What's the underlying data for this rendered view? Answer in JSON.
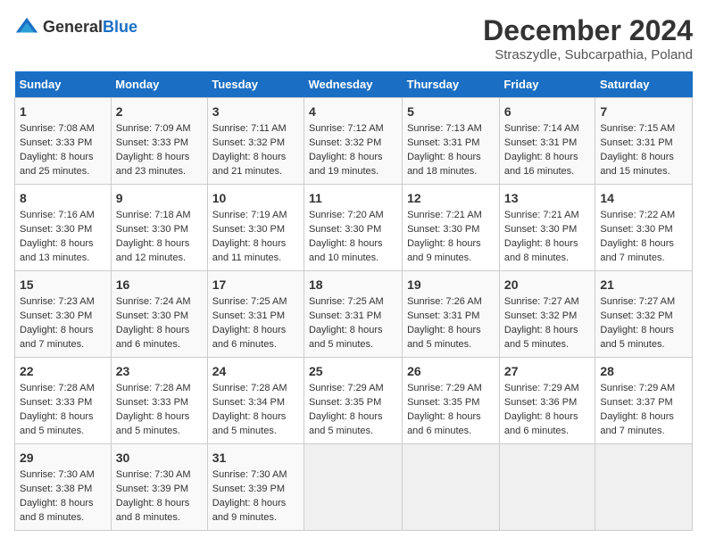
{
  "logo": {
    "general": "General",
    "blue": "Blue"
  },
  "title": "December 2024",
  "subtitle": "Straszydle, Subcarpathia, Poland",
  "days_header": [
    "Sunday",
    "Monday",
    "Tuesday",
    "Wednesday",
    "Thursday",
    "Friday",
    "Saturday"
  ],
  "weeks": [
    [
      {
        "day": "1",
        "sunrise": "7:08 AM",
        "sunset": "3:33 PM",
        "daylight": "8 hours and 25 minutes."
      },
      {
        "day": "2",
        "sunrise": "7:09 AM",
        "sunset": "3:33 PM",
        "daylight": "8 hours and 23 minutes."
      },
      {
        "day": "3",
        "sunrise": "7:11 AM",
        "sunset": "3:32 PM",
        "daylight": "8 hours and 21 minutes."
      },
      {
        "day": "4",
        "sunrise": "7:12 AM",
        "sunset": "3:32 PM",
        "daylight": "8 hours and 19 minutes."
      },
      {
        "day": "5",
        "sunrise": "7:13 AM",
        "sunset": "3:31 PM",
        "daylight": "8 hours and 18 minutes."
      },
      {
        "day": "6",
        "sunrise": "7:14 AM",
        "sunset": "3:31 PM",
        "daylight": "8 hours and 16 minutes."
      },
      {
        "day": "7",
        "sunrise": "7:15 AM",
        "sunset": "3:31 PM",
        "daylight": "8 hours and 15 minutes."
      }
    ],
    [
      {
        "day": "8",
        "sunrise": "7:16 AM",
        "sunset": "3:30 PM",
        "daylight": "8 hours and 13 minutes."
      },
      {
        "day": "9",
        "sunrise": "7:18 AM",
        "sunset": "3:30 PM",
        "daylight": "8 hours and 12 minutes."
      },
      {
        "day": "10",
        "sunrise": "7:19 AM",
        "sunset": "3:30 PM",
        "daylight": "8 hours and 11 minutes."
      },
      {
        "day": "11",
        "sunrise": "7:20 AM",
        "sunset": "3:30 PM",
        "daylight": "8 hours and 10 minutes."
      },
      {
        "day": "12",
        "sunrise": "7:21 AM",
        "sunset": "3:30 PM",
        "daylight": "8 hours and 9 minutes."
      },
      {
        "day": "13",
        "sunrise": "7:21 AM",
        "sunset": "3:30 PM",
        "daylight": "8 hours and 8 minutes."
      },
      {
        "day": "14",
        "sunrise": "7:22 AM",
        "sunset": "3:30 PM",
        "daylight": "8 hours and 7 minutes."
      }
    ],
    [
      {
        "day": "15",
        "sunrise": "7:23 AM",
        "sunset": "3:30 PM",
        "daylight": "8 hours and 7 minutes."
      },
      {
        "day": "16",
        "sunrise": "7:24 AM",
        "sunset": "3:30 PM",
        "daylight": "8 hours and 6 minutes."
      },
      {
        "day": "17",
        "sunrise": "7:25 AM",
        "sunset": "3:31 PM",
        "daylight": "8 hours and 6 minutes."
      },
      {
        "day": "18",
        "sunrise": "7:25 AM",
        "sunset": "3:31 PM",
        "daylight": "8 hours and 5 minutes."
      },
      {
        "day": "19",
        "sunrise": "7:26 AM",
        "sunset": "3:31 PM",
        "daylight": "8 hours and 5 minutes."
      },
      {
        "day": "20",
        "sunrise": "7:27 AM",
        "sunset": "3:32 PM",
        "daylight": "8 hours and 5 minutes."
      },
      {
        "day": "21",
        "sunrise": "7:27 AM",
        "sunset": "3:32 PM",
        "daylight": "8 hours and 5 minutes."
      }
    ],
    [
      {
        "day": "22",
        "sunrise": "7:28 AM",
        "sunset": "3:33 PM",
        "daylight": "8 hours and 5 minutes."
      },
      {
        "day": "23",
        "sunrise": "7:28 AM",
        "sunset": "3:33 PM",
        "daylight": "8 hours and 5 minutes."
      },
      {
        "day": "24",
        "sunrise": "7:28 AM",
        "sunset": "3:34 PM",
        "daylight": "8 hours and 5 minutes."
      },
      {
        "day": "25",
        "sunrise": "7:29 AM",
        "sunset": "3:35 PM",
        "daylight": "8 hours and 5 minutes."
      },
      {
        "day": "26",
        "sunrise": "7:29 AM",
        "sunset": "3:35 PM",
        "daylight": "8 hours and 6 minutes."
      },
      {
        "day": "27",
        "sunrise": "7:29 AM",
        "sunset": "3:36 PM",
        "daylight": "8 hours and 6 minutes."
      },
      {
        "day": "28",
        "sunrise": "7:29 AM",
        "sunset": "3:37 PM",
        "daylight": "8 hours and 7 minutes."
      }
    ],
    [
      {
        "day": "29",
        "sunrise": "7:30 AM",
        "sunset": "3:38 PM",
        "daylight": "8 hours and 8 minutes."
      },
      {
        "day": "30",
        "sunrise": "7:30 AM",
        "sunset": "3:39 PM",
        "daylight": "8 hours and 8 minutes."
      },
      {
        "day": "31",
        "sunrise": "7:30 AM",
        "sunset": "3:39 PM",
        "daylight": "8 hours and 9 minutes."
      },
      null,
      null,
      null,
      null
    ]
  ],
  "labels": {
    "sunrise": "Sunrise:",
    "sunset": "Sunset:",
    "daylight": "Daylight:"
  }
}
